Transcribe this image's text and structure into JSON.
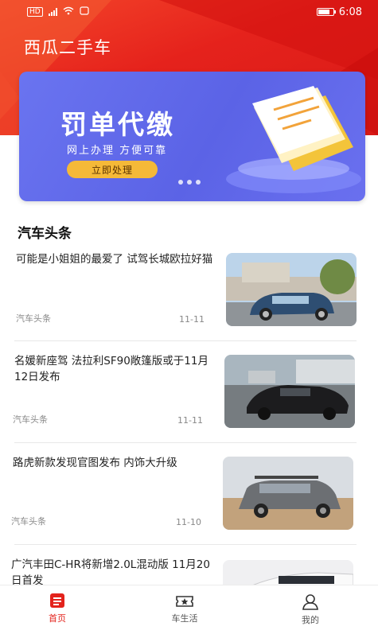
{
  "status_bar": {
    "time": "6:08",
    "carrier": "HD"
  },
  "app": {
    "title": "西瓜二手车"
  },
  "banner": {
    "title": "罚单代缴",
    "subtitle": "网上办理 方便可靠",
    "button_label": "立即处理"
  },
  "section": {
    "title": "汽车头条"
  },
  "news": [
    {
      "title": "可能是小姐姐的最爱了 试驾长城欧拉好猫",
      "source": "汽车头条",
      "date": "11-11"
    },
    {
      "title": "名媛新座驾 法拉利SF90敞篷版或于11月12日发布",
      "source": "汽车头条",
      "date": "11-11"
    },
    {
      "title": "路虎新款发现官图发布 内饰大升级",
      "source": "汽车头条",
      "date": "11-10"
    },
    {
      "title": "广汽丰田C-HR将新增2.0L混动版 11月20日首发",
      "source": "",
      "date": ""
    }
  ],
  "tabbar": {
    "items": [
      {
        "label": "首页",
        "icon": "news-icon",
        "active": true
      },
      {
        "label": "车生活",
        "icon": "ticket-icon",
        "active": false
      },
      {
        "label": "我的",
        "icon": "user-icon",
        "active": false
      }
    ]
  },
  "colors": {
    "brand_red": "#e3231c",
    "banner_purple": "#5b63e6",
    "banner_button": "#f5b938"
  }
}
